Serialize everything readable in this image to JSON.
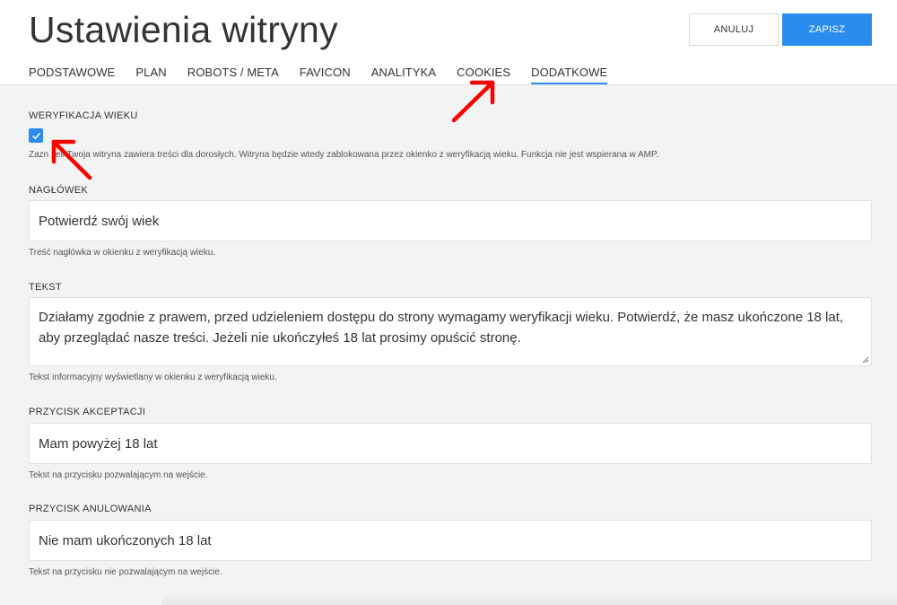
{
  "header": {
    "title": "Ustawienia witryny",
    "cancel_label": "ANULUJ",
    "save_label": "ZAPISZ"
  },
  "tabs": [
    {
      "label": "PODSTAWOWE",
      "active": false
    },
    {
      "label": "PLAN",
      "active": false
    },
    {
      "label": "ROBOTS / META",
      "active": false
    },
    {
      "label": "FAVICON",
      "active": false
    },
    {
      "label": "ANALITYKA",
      "active": false
    },
    {
      "label": "COOKIES",
      "active": false
    },
    {
      "label": "DODATKOWE",
      "active": true
    }
  ],
  "age_verification": {
    "label": "WERYFIKACJA WIEKU",
    "checked": true,
    "hint_visible": "Zazn      żeli Twoja witryna zawiera treści dla dorosłych. Witryna będzie wtedy zablokowana przez okienko z weryfikacją wieku. Funkcja nie jest wspierana w AMP."
  },
  "heading_field": {
    "label": "NAGŁÓWEK",
    "value": "Potwierdź swój wiek",
    "hint": "Treść nagłówka w okienku z weryfikacją wieku."
  },
  "text_field": {
    "label": "TEKST",
    "value": "Działamy zgodnie z prawem, przed udzieleniem dostępu do strony wymagamy weryfikacji wieku. Potwierdź, że masz ukończone 18 lat, aby przeglądać nasze treści. Jeżeli nie ukończyłeś 18 lat prosimy opuścić stronę.",
    "hint": "Tekst informacyjny wyświetlany w okienku z weryfikacją wieku."
  },
  "accept_button_field": {
    "label": "PRZYCISK AKCEPTACJI",
    "value": "Mam powyżej 18 lat",
    "hint": "Tekst na przycisku pozwalającym na wejście."
  },
  "cancel_button_field": {
    "label": "PRZYCISK ANULOWANIA",
    "value": "Nie mam ukończonych 18 lat",
    "hint": "Tekst na przycisku nie pozwalającym na wejście."
  },
  "colors": {
    "accent": "#2b8cf0",
    "annotation_arrow": "#ff0000"
  }
}
